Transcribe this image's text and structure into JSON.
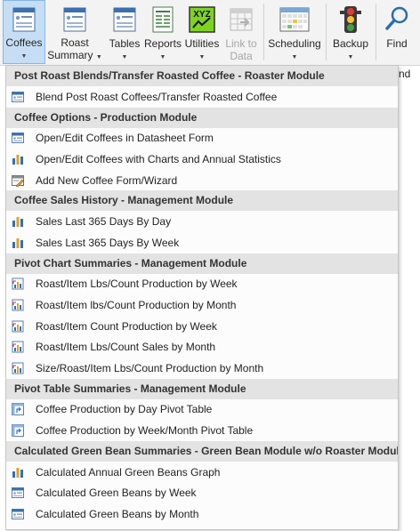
{
  "ribbon": {
    "buttons": [
      {
        "key": "coffees",
        "label": "Coffees",
        "icon": "form-icon",
        "has_caret": true
      },
      {
        "key": "roast",
        "label": "Roast",
        "label2": "Summary",
        "icon": "form-icon",
        "has_caret": true
      },
      {
        "key": "tables",
        "label": "Tables",
        "icon": "form-icon",
        "has_caret": true
      },
      {
        "key": "reports",
        "label": "Reports",
        "icon": "report-icon",
        "has_caret": true
      },
      {
        "key": "utilities",
        "label": "Utilities",
        "icon": "utilities-icon",
        "has_caret": true
      },
      {
        "key": "link",
        "label": "Link to",
        "label2": "Data",
        "icon": "link-table-icon",
        "has_caret": false
      },
      {
        "key": "scheduling",
        "label": "Scheduling",
        "icon": "calendar-icon",
        "has_caret": true
      },
      {
        "key": "backup",
        "label": "Backup",
        "icon": "traffic-light-icon",
        "has_caret": true
      },
      {
        "key": "find",
        "label": "Find",
        "icon": "magnifier-icon",
        "has_caret": false
      }
    ],
    "partial_text": "nd"
  },
  "menu": {
    "sections": [
      {
        "header": "Post Roast Blends/Transfer Roasted Coffee  - Roaster Module",
        "items": [
          {
            "label": "Blend Post Roast Coffees/Transfer Roasted Coffee",
            "icon": "form-icon"
          }
        ]
      },
      {
        "header": "Coffee Options - Production Module",
        "items": [
          {
            "label": "Open/Edit Coffees in Datasheet Form",
            "icon": "form-icon"
          },
          {
            "label": "Open/Edit Coffees with Charts and Annual Statistics",
            "icon": "chart-icon"
          },
          {
            "label": "Add New Coffee Form/Wizard",
            "icon": "add-form-icon"
          }
        ]
      },
      {
        "header": "Coffee Sales History - Management Module",
        "items": [
          {
            "label": "Sales Last 365 Days By Day",
            "icon": "chart-icon"
          },
          {
            "label": "Sales Last 365 Days By Week",
            "icon": "chart-icon"
          }
        ]
      },
      {
        "header": "Pivot Chart Summaries - Management Module",
        "items": [
          {
            "label": "Roast/Item Lbs/Count Production by Week",
            "icon": "pivot-chart-icon"
          },
          {
            "label": "Roast/Item lbs/Count Production by Month",
            "icon": "pivot-chart-icon"
          },
          {
            "label": "Roast/Item Count Production by Week",
            "icon": "pivot-chart-icon"
          },
          {
            "label": "Roast/Item Lbs/Count Sales by Month",
            "icon": "pivot-chart-icon"
          },
          {
            "label": "Size/Roast/Item Lbs/Count Production by Month",
            "icon": "pivot-chart-icon"
          }
        ]
      },
      {
        "header": "Pivot Table Summaries - Management Module",
        "items": [
          {
            "label": "Coffee Production by Day Pivot Table",
            "icon": "pivot-table-icon"
          },
          {
            "label": "Coffee Production by Week/Month  Pivot Table",
            "icon": "pivot-table-icon"
          }
        ]
      },
      {
        "header": "Calculated Green Bean Summaries - Green Bean Module w/o Roaster Module",
        "items": [
          {
            "label": "Calculated Annual Green Beans Graph",
            "icon": "chart-icon"
          },
          {
            "label": "Calculated Green Beans by Week",
            "icon": "form-icon"
          },
          {
            "label": "Calculated Green Beans by Month",
            "icon": "form-icon"
          }
        ]
      }
    ]
  },
  "colors": {
    "ribbon_bg": "#f3f3f3",
    "active_button_bg": "#c5def5",
    "section_header_bg": "#e3e3e3",
    "menu_bg": "#fcfcfc"
  }
}
